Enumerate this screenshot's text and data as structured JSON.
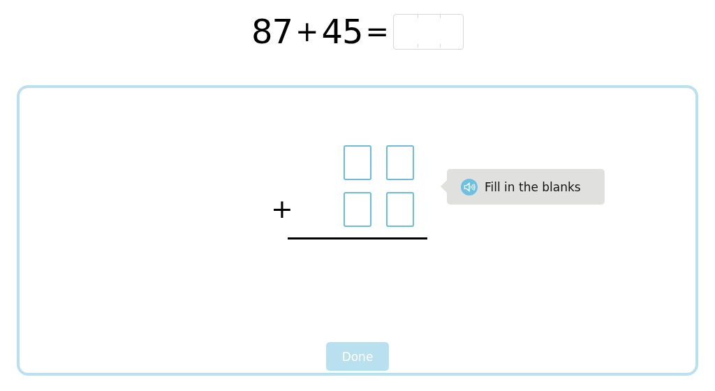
{
  "equation": {
    "operand_1": "87",
    "operator": "+",
    "operand_2": "45",
    "equals": "="
  },
  "addition": {
    "rows": [
      {
        "kind": "addend"
      },
      {
        "kind": "addend",
        "operator": "+"
      }
    ]
  },
  "hint": {
    "text": "Fill in the blanks"
  },
  "done_button": {
    "label": "Done",
    "disabled": true
  }
}
